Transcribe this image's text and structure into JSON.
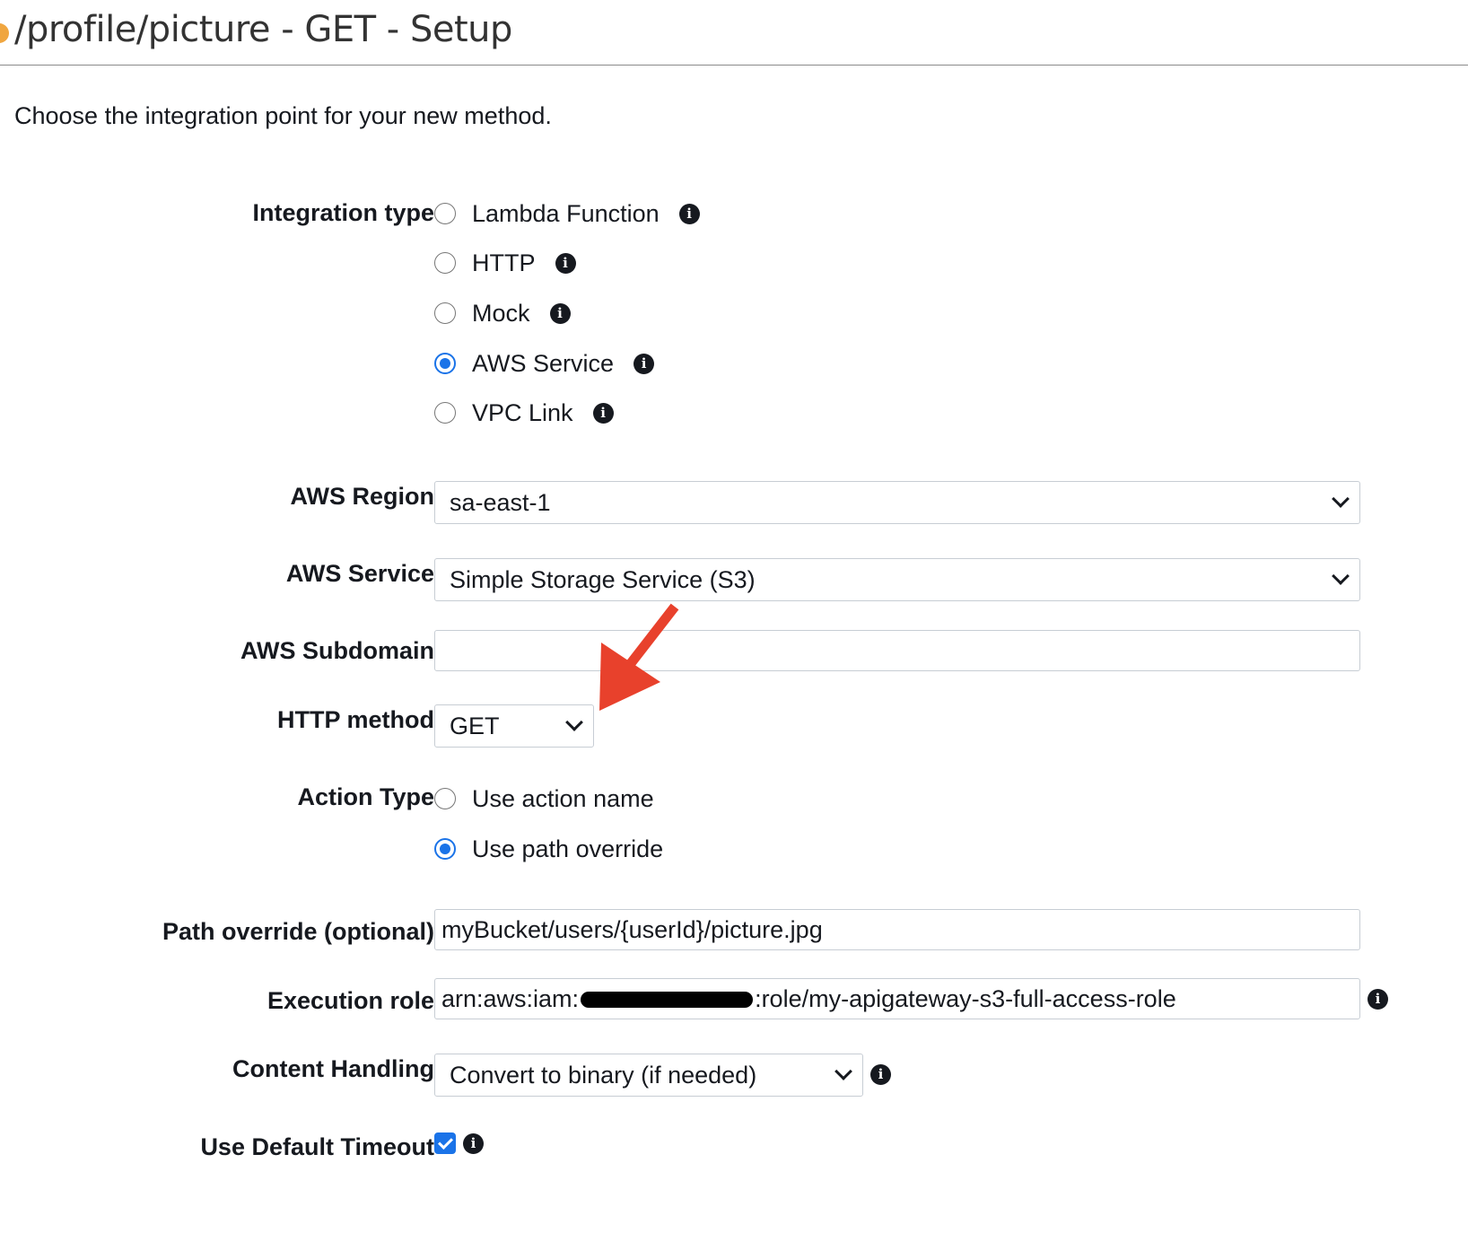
{
  "header": {
    "title": "/profile/picture - GET - Setup",
    "intro": "Choose the integration point for your new method."
  },
  "integration_type": {
    "label": "Integration type",
    "options": [
      {
        "label": "Lambda Function",
        "selected": false
      },
      {
        "label": "HTTP",
        "selected": false
      },
      {
        "label": "Mock",
        "selected": false
      },
      {
        "label": "AWS Service",
        "selected": true
      },
      {
        "label": "VPC Link",
        "selected": false
      }
    ]
  },
  "aws_region": {
    "label": "AWS Region",
    "value": "sa-east-1"
  },
  "aws_service": {
    "label": "AWS Service",
    "value": "Simple Storage Service (S3)"
  },
  "aws_subdomain": {
    "label": "AWS Subdomain",
    "value": ""
  },
  "http_method": {
    "label": "HTTP method",
    "value": "GET"
  },
  "action_type": {
    "label": "Action Type",
    "options": [
      {
        "label": "Use action name",
        "selected": false
      },
      {
        "label": "Use path override",
        "selected": true
      }
    ]
  },
  "path_override": {
    "label": "Path override (optional)",
    "value": "myBucket/users/{userId}/picture.jpg"
  },
  "execution_role": {
    "label": "Execution role",
    "value_prefix": "arn:aws:iam:",
    "value_suffix": ":role/my-apigateway-s3-full-access-role"
  },
  "content_handling": {
    "label": "Content Handling",
    "value": "Convert to binary (if needed)"
  },
  "default_timeout": {
    "label": "Use Default Timeout",
    "checked": true
  },
  "colors": {
    "accent": "#1a73e8",
    "annotation_arrow": "#e8412c",
    "title_dot": "#f0a640"
  }
}
